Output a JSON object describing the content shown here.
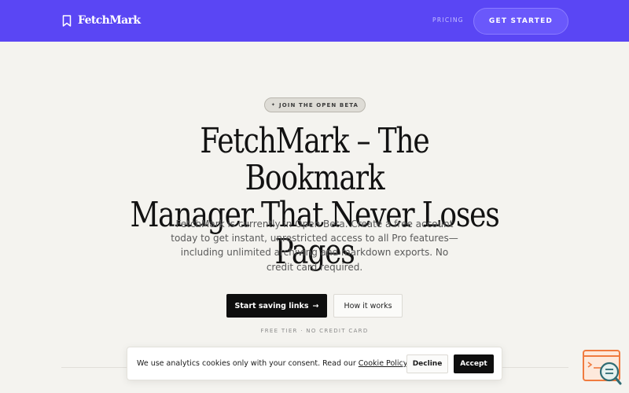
{
  "header": {
    "brand": "FetchMark",
    "nav_pricing": "PRICING",
    "cta_label": "GET STARTED"
  },
  "hero": {
    "badge_icon": "sparkle-icon",
    "badge": "JOIN THE OPEN BETA",
    "title_line1": "FetchMark – The Bookmark",
    "title_line2": "Manager That Never Loses Pages",
    "description": "FetchMark is currently in Open Beta. Create a free account today to get instant, unrestricted access to all Pro features—including unlimited archiving and markdown exports. No credit card required.",
    "primary_cta": "Start saving links",
    "secondary_cta": "How it works",
    "note": "FREE TIER · NO CREDIT CARD"
  },
  "cookie": {
    "text": "We use analytics cookies only with your consent. Read our",
    "link": "Cookie Policy",
    "after_link": ".",
    "decline": "Decline",
    "accept": "Accept"
  },
  "colors": {
    "header_bg": "#5a46f4",
    "page_bg": "#f4f3ef",
    "primary_button": "#0e0e0e",
    "widget_orange": "#f07b3f",
    "widget_teal": "#2f6b73"
  }
}
